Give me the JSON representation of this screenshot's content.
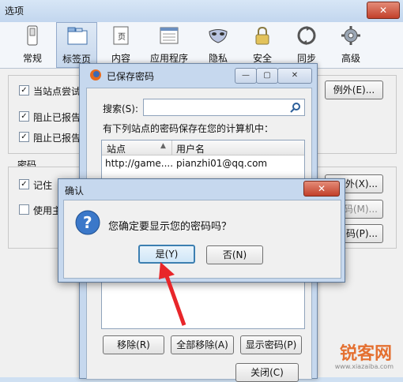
{
  "window": {
    "title": "选项",
    "close_glyph": "✕"
  },
  "toolbar": [
    {
      "label": "常规",
      "icon": "switch-icon",
      "selected": false
    },
    {
      "label": "标签页",
      "icon": "tabs-icon",
      "selected": true
    },
    {
      "label": "内容",
      "icon": "page-icon",
      "selected": false
    },
    {
      "label": "应用程序",
      "icon": "apps-icon",
      "selected": false
    },
    {
      "label": "隐私",
      "icon": "mask-icon",
      "selected": false
    },
    {
      "label": "安全",
      "icon": "lock-icon",
      "selected": false
    },
    {
      "label": "同步",
      "icon": "sync-icon",
      "selected": false
    },
    {
      "label": "高级",
      "icon": "gear-icon",
      "selected": false
    }
  ],
  "security": {
    "items": [
      {
        "label": "当站点尝试",
        "checked": true
      },
      {
        "label": "阻止已报告",
        "checked": true
      },
      {
        "label": "阻止已报告",
        "checked": true
      }
    ],
    "exceptions_button": "例外(E)...",
    "passwords_heading": "密码",
    "remember_label": "记住",
    "use_master_label": "使用主",
    "exceptions_button_2": "外(X)...",
    "change_master_button": "码(M)...",
    "saved_passwords_button": "码(P)..."
  },
  "saved_passwords": {
    "title": "已保存密码",
    "search_label": "搜索(S):",
    "search_value": "",
    "description": "有下列站点的密码保存在您的计算机中：",
    "columns": [
      "站点",
      "用户名"
    ],
    "rows": [
      {
        "site": "http://game....",
        "username": "pianzhi01@qq.com"
      }
    ],
    "remove_button": "移除(R)",
    "remove_all_button": "全部移除(A)",
    "show_passwords_button": "显示密码(P)",
    "close_button": "关闭(C)"
  },
  "confirm": {
    "title": "确认",
    "message": "您确定要显示您的密码吗？",
    "yes_button": "是(Y)",
    "no_button": "否(N)",
    "close_glyph": "✕"
  },
  "watermark": {
    "text": "锐客网",
    "subtext": "www.xiazaiba.com"
  },
  "colors": {
    "accent_arrow": "#e8262a",
    "selected_button_border": "#3c7fb1"
  }
}
